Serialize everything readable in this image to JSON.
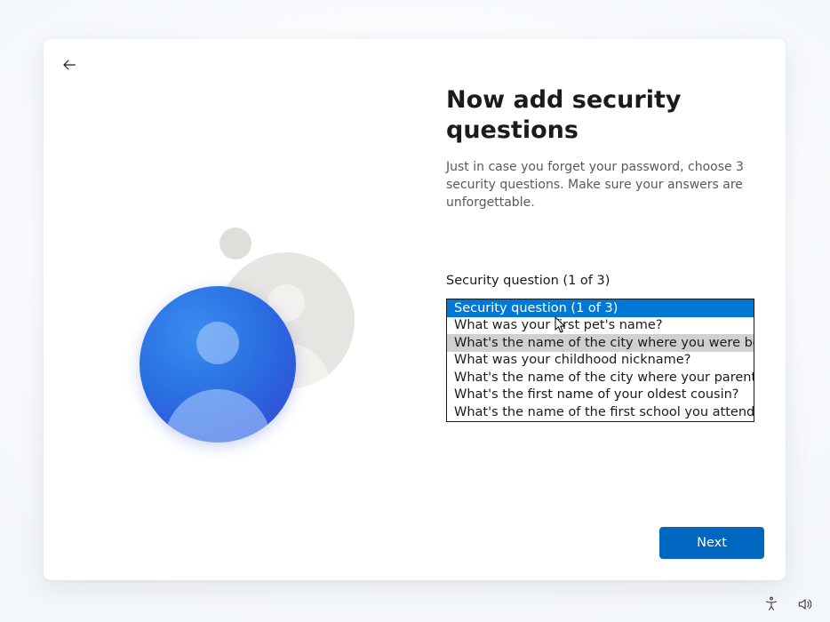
{
  "header": {
    "title": "Now add security questions",
    "subtitle": "Just in case you forget your password, choose 3 security questions. Make sure your answers are unforgettable."
  },
  "security_question": {
    "label": "Security question (1 of 3)",
    "options": [
      "Security question (1 of 3)",
      "What was your first pet's name?",
      "What's the name of the city where you were born?",
      "What was your childhood nickname?",
      "What's the name of the city where your parents met",
      "What's the first name of your oldest cousin?",
      "What's the name of the first school you attended?"
    ],
    "selected_index": 0,
    "hovered_index": 2
  },
  "buttons": {
    "next": "Next"
  }
}
